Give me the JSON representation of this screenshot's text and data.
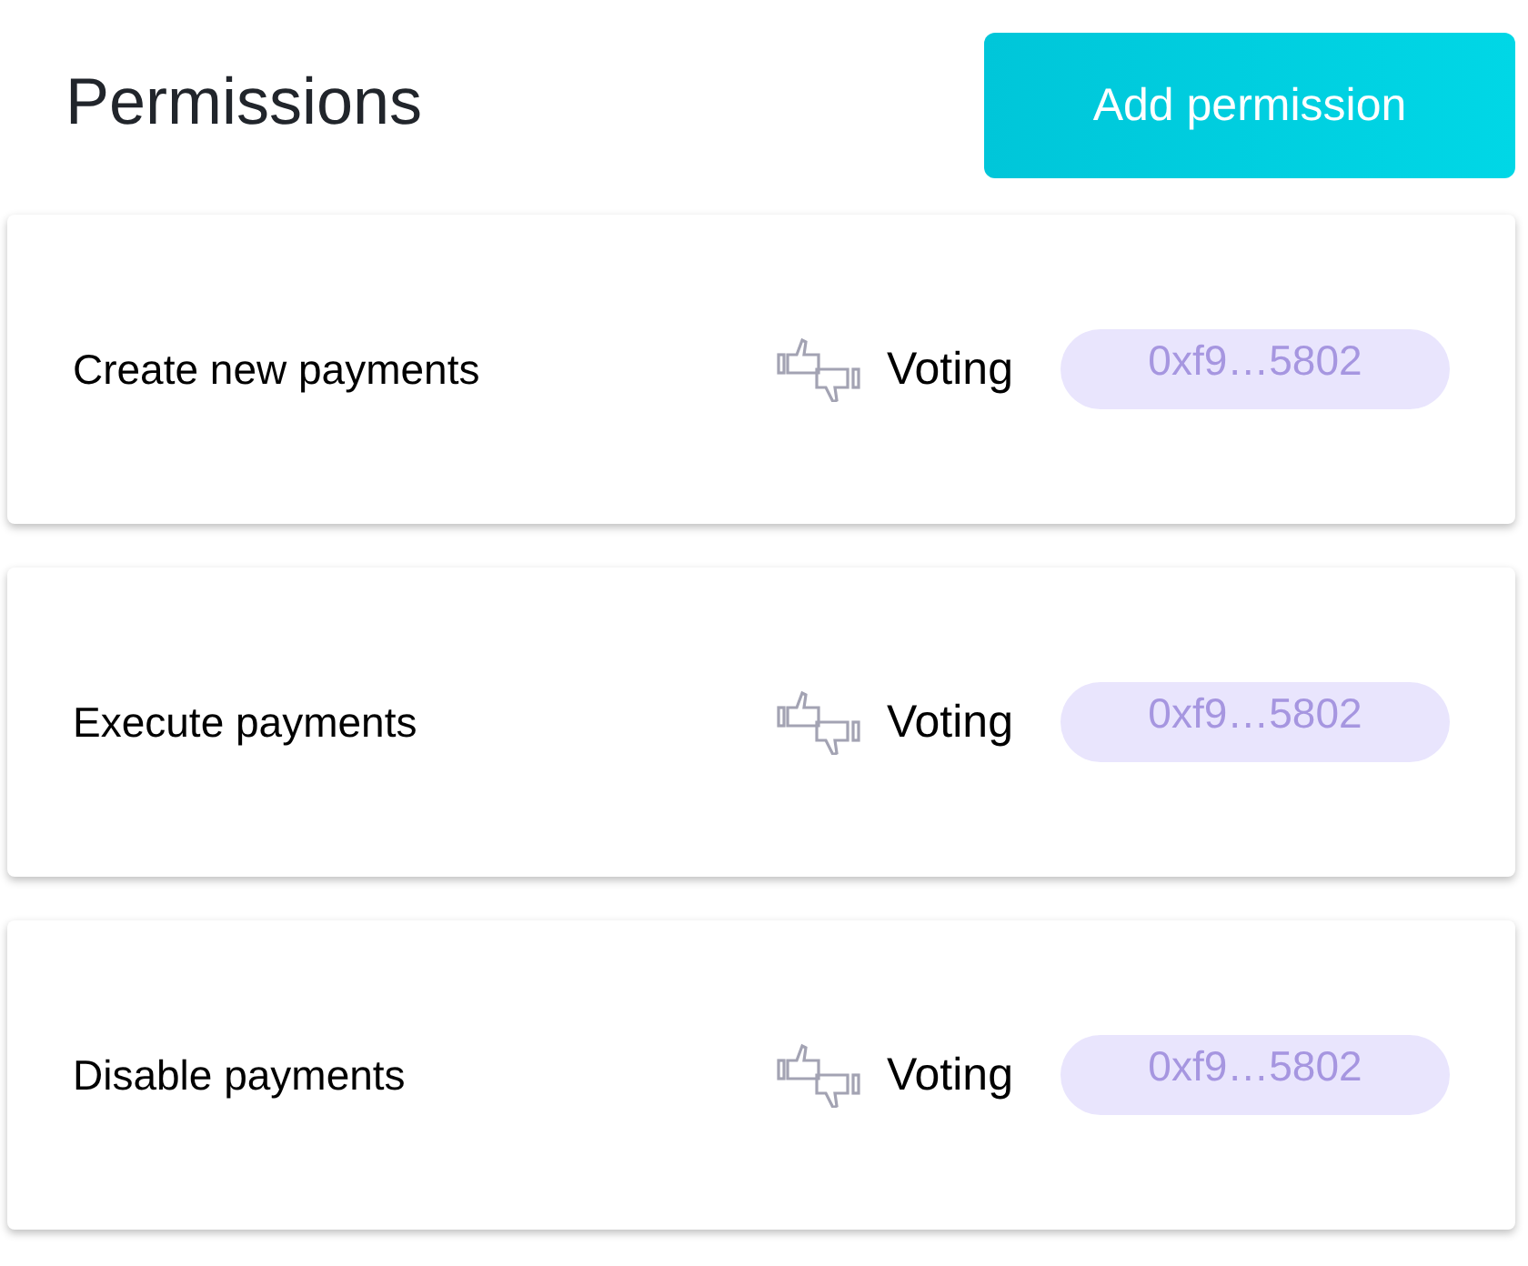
{
  "title": "Permissions",
  "add_button": "Add permission",
  "permissions": [
    {
      "action": "Create new payments",
      "app": "Voting",
      "address": "0xf9…5802"
    },
    {
      "action": "Execute payments",
      "app": "Voting",
      "address": "0xf9…5802"
    },
    {
      "action": "Disable payments",
      "app": "Voting",
      "address": "0xf9…5802"
    }
  ]
}
